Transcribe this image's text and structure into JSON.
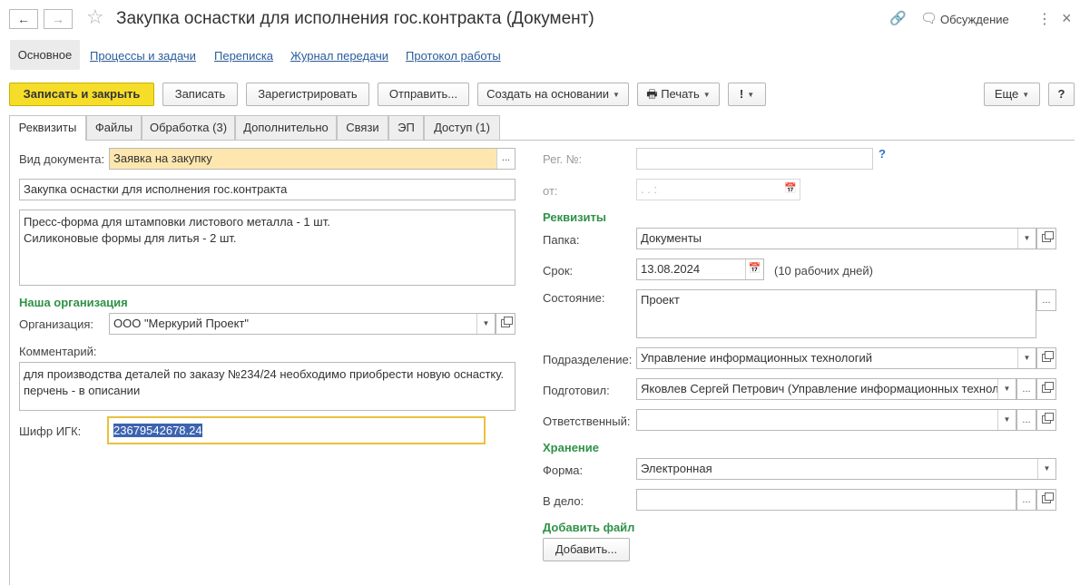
{
  "window": {
    "title": "Закупка оснастки для исполнения гос.контракта (Документ)",
    "back_icon": "arrow-left-icon",
    "forward_icon": "arrow-right-icon",
    "favorite_icon": "star-icon",
    "discussion_label": "Обсуждение",
    "more_glyph": "⋮",
    "close_glyph": "×"
  },
  "nav": {
    "main": "Основное",
    "links": [
      "Процессы и задачи",
      "Переписка",
      "Журнал передачи",
      "Протокол работы"
    ]
  },
  "toolbar": {
    "save_close": "Записать и закрыть",
    "save": "Записать",
    "register": "Зарегистрировать",
    "send": "Отправить...",
    "create_based": "Создать на основании",
    "print": "Печать",
    "important": "!",
    "more": "Еще",
    "help": "?"
  },
  "tabs": [
    "Реквизиты",
    "Файлы",
    "Обработка (3)",
    "Дополнительно",
    "Связи",
    "ЭП",
    "Доступ (1)"
  ],
  "left": {
    "doc_type_label": "Вид документа:",
    "doc_type_value": "Заявка на закупку",
    "subject": "Закупка оснастки для исполнения гос.контракта",
    "content_line1": "Пресс-форма для штамповки листового металла - 1 шт.",
    "content_line2": "Силиконовые формы для литья - 2 шт.",
    "our_org_section": "Наша организация",
    "org_label": "Организация:",
    "org_value": "ООО \"Меркурий Проект\"",
    "comment_label": "Комментарий:",
    "comment_line1": "для производства деталей по заказу №234/24 необходимо приобрести новую оснастку.",
    "comment_line2": "перчень - в описании",
    "cipher_label": "Шифр ИГК:",
    "cipher_value": "23679542678.24"
  },
  "right": {
    "reg_no_label": "Рег. №:",
    "reg_no_value": "",
    "reg_help": "?",
    "from_label": "от:",
    "from_placeholder": " .  .     :",
    "requisites_section": "Реквизиты",
    "folder_label": "Папка:",
    "folder_value": "Документы",
    "deadline_label": "Срок:",
    "deadline_value": "13.08.2024",
    "deadline_note": "(10 рабочих дней)",
    "state_label": "Состояние:",
    "state_value": "Проект",
    "dept_label": "Подразделение:",
    "dept_value": "Управление информационных технологий",
    "prepared_label": "Подготовил:",
    "prepared_value": "Яковлев Сергей Петрович (Управление информационных техноло",
    "responsible_label": "Ответственный:",
    "responsible_value": "",
    "storage_section": "Хранение",
    "form_label": "Форма:",
    "form_value": "Электронная",
    "case_label": "В дело:",
    "case_value": "",
    "add_file_section": "Добавить файл",
    "add_button": "Добавить..."
  },
  "colors": {
    "primary_button": "#f5dd2a",
    "section_header": "#2e9247",
    "link": "#2a5c9b",
    "highlight_field": "#fde7ae",
    "focus_border": "#e8c13a"
  }
}
